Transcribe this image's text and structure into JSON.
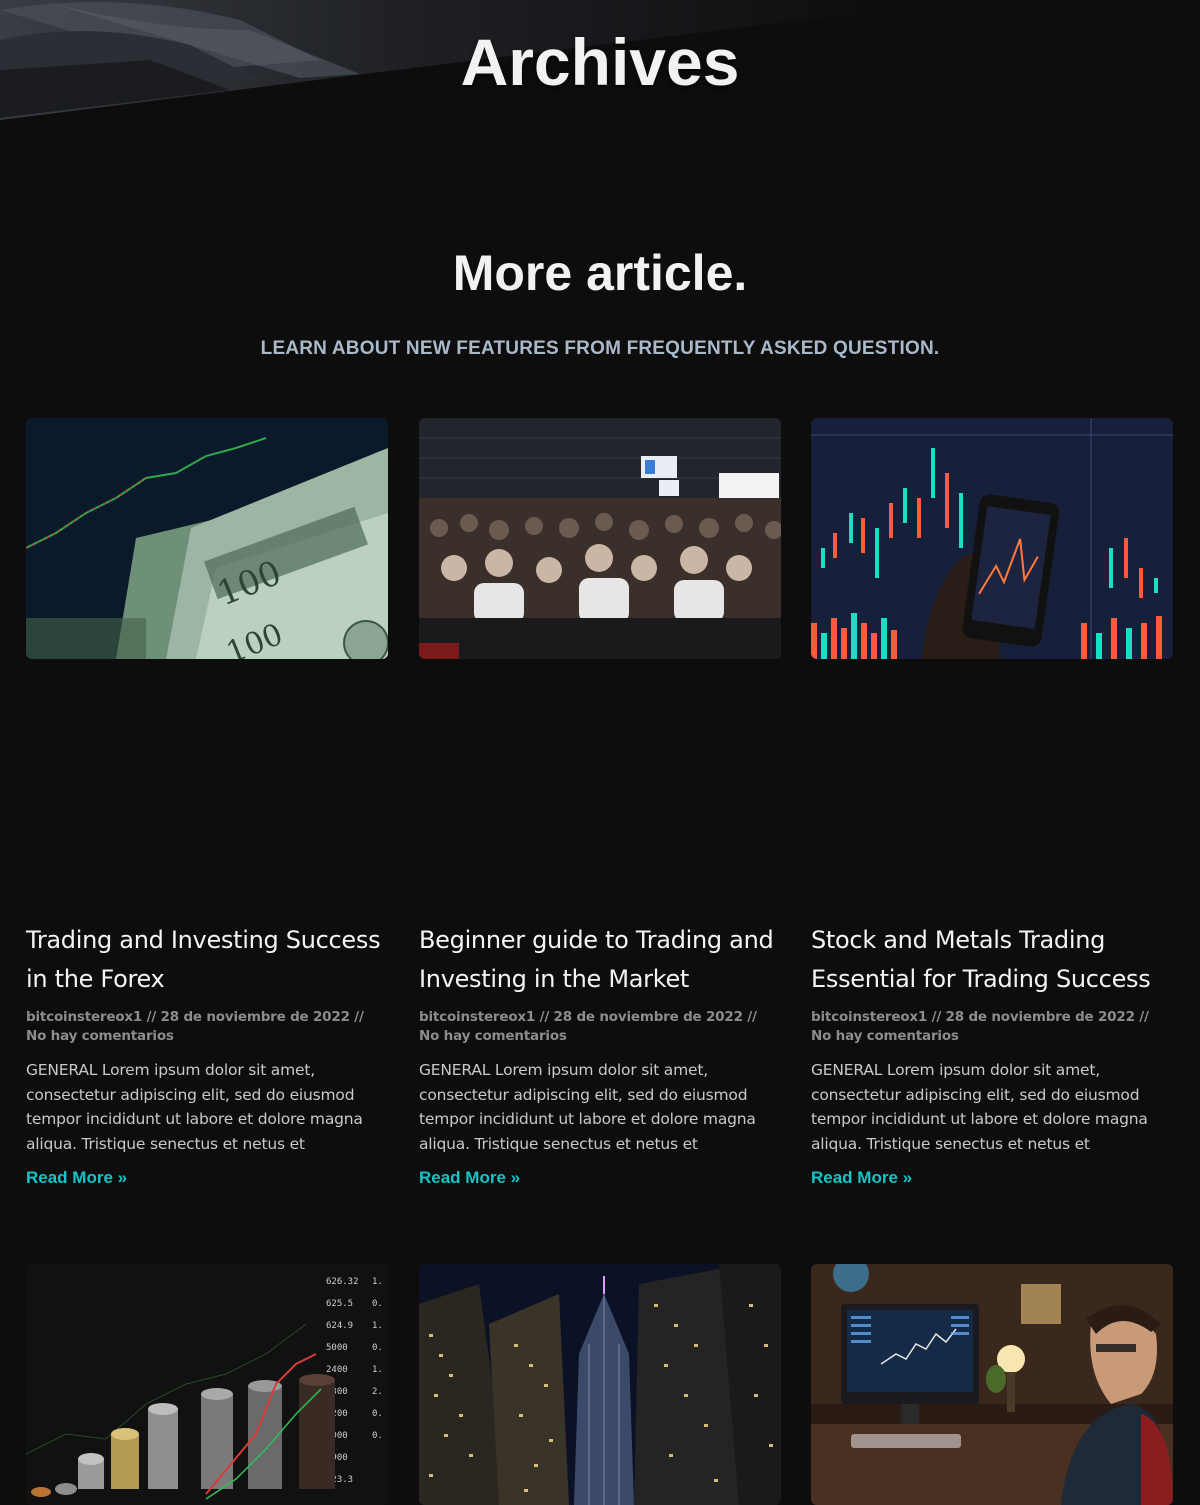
{
  "header": {
    "title": "Archives"
  },
  "section": {
    "heading": "More article.",
    "subheading": "LEARN ABOUT NEW FEATURES FROM FREQUENTLY ASKED QUESTION."
  },
  "articles": [
    {
      "title": "Trading and Investing Success in the Forex",
      "meta": "bitcoinstereox1 // 28 de noviembre de 2022 // No hay comentarios",
      "excerpt": "GENERAL Lorem ipsum dolor sit amet, consectetur adipiscing elit, sed do eiusmod tempor incididunt ut labore et dolore magna aliqua. Tristique senectus et netus et",
      "read_more": "Read More »",
      "image": "dollar-bills-chart-image"
    },
    {
      "title": "Beginner guide to Trading and Investing in the Market",
      "meta": "bitcoinstereox1 // 28 de noviembre de 2022 // No hay comentarios",
      "excerpt": "GENERAL Lorem ipsum dolor sit amet, consectetur adipiscing elit, sed do eiusmod tempor incididunt ut labore et dolore magna aliqua. Tristique senectus et netus et",
      "read_more": "Read More »",
      "image": "conference-audience-image"
    },
    {
      "title": "Stock and Metals Trading Essential for Trading Success",
      "meta": "bitcoinstereox1 // 28 de noviembre de 2022 // No hay comentarios",
      "excerpt": "GENERAL Lorem ipsum dolor sit amet, consectetur adipiscing elit, sed do eiusmod tempor incididunt ut labore et dolore magna aliqua. Tristique senectus et netus et",
      "read_more": "Read More »",
      "image": "phone-candlestick-chart-image"
    },
    {
      "image": "coin-stacks-chart-image"
    },
    {
      "image": "city-skyscrapers-night-image"
    },
    {
      "image": "trader-at-desk-image"
    }
  ],
  "colors": {
    "background": "#0d0d0e",
    "accent": "#16c3c6",
    "subheading": "#a9b9c9",
    "meta": "#8c8c8c"
  }
}
